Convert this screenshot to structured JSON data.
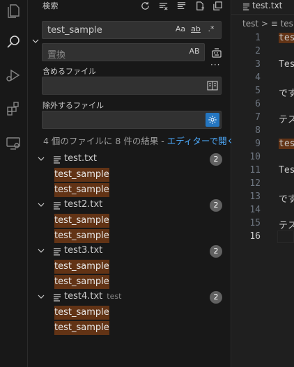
{
  "sidebar": {
    "title": "検索",
    "search_value": "test_sample",
    "search_opts": [
      "Aa",
      "ab",
      ".*"
    ],
    "replace_placeholder": "置換",
    "replace_opt": "AB",
    "include_label": "含めるファイル",
    "exclude_label": "除外するファイル",
    "summary_text": "4 個のファイルに 8 件の結果 - ",
    "summary_link": "エディターで開く",
    "results": [
      {
        "name": "test.txt",
        "dir": "",
        "count": "2",
        "matches": [
          "test_sample",
          "test_sample"
        ]
      },
      {
        "name": "test2.txt",
        "dir": "",
        "count": "2",
        "matches": [
          "test_sample",
          "test_sample"
        ]
      },
      {
        "name": "test3.txt",
        "dir": "",
        "count": "2",
        "matches": [
          "test_sample",
          "test_sample"
        ]
      },
      {
        "name": "test4.txt",
        "dir": "test",
        "count": "2",
        "matches": [
          "test_sample",
          "test_sample"
        ]
      }
    ]
  },
  "editor": {
    "tab_name": "test.txt",
    "breadcrumb": "test > ≡ tes",
    "line_numbers": [
      "1",
      "2",
      "3",
      "4",
      "5",
      "6",
      "7",
      "8",
      "9",
      "10",
      "11",
      "12",
      "13",
      "14",
      "15",
      "16"
    ],
    "active_line": "16",
    "lines": [
      "tes",
      "",
      "Tes",
      "",
      "です",
      "",
      "テス",
      "",
      "tes",
      "",
      "Tes",
      "",
      "です",
      "",
      "テス",
      ""
    ]
  },
  "colors": {
    "match_bg": "#623315",
    "accent": "#2476c1",
    "link": "#4daafc"
  }
}
